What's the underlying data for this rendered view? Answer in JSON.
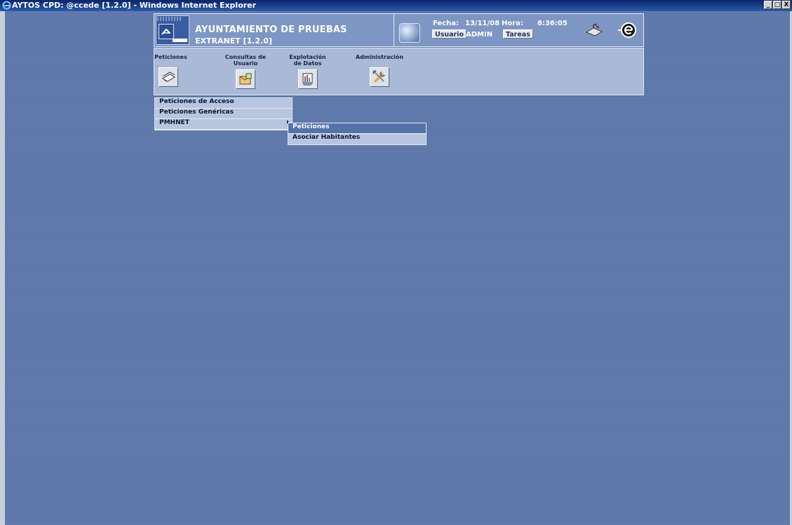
{
  "window": {
    "title": "AYTOS CPD: @ccede [1.2.0] - Windows Internet Explorer",
    "buttons": {
      "minimize": "_",
      "maximize": "□",
      "close": "X"
    }
  },
  "header": {
    "org_name": "AYUNTAMIENTO DE PRUEBAS",
    "subtitle": "EXTRANET [1.2.0]",
    "fecha_label": "Fecha:",
    "fecha_value": "13/11/08",
    "hora_label": "Hora:",
    "hora_value": "8:36:05",
    "usuario_button": "Usuario",
    "usuario_value": "ADMIN",
    "tareas_button": "Tareas"
  },
  "modules": [
    {
      "label": "Peticiones",
      "icon": "peticiones-icon"
    },
    {
      "label": "Consultas de Usuario",
      "icon": "consultas-icon"
    },
    {
      "label": "Explotación de Datos",
      "icon": "explotacion-icon"
    },
    {
      "label": "Administración",
      "icon": "administracion-icon"
    }
  ],
  "menu": {
    "items": [
      "Peticiones de Acceso",
      "Peticiones Genéricas",
      "PMHNET"
    ]
  },
  "submenu": {
    "items": [
      "Peticiones",
      "Asociar Habitantes"
    ],
    "active_index": 0
  },
  "colors": {
    "desktop": "#5a74a8",
    "header": "#7d96c4",
    "modbar": "#a9bad6",
    "menu": "#b7c5df",
    "menu_active": "#5471aa"
  }
}
